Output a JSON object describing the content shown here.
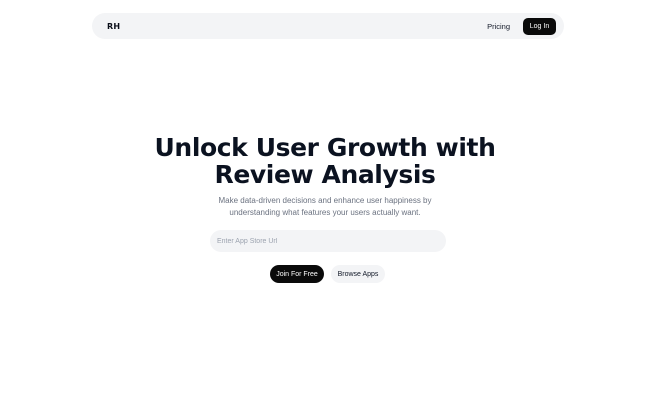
{
  "nav": {
    "logo": "RH",
    "pricing_label": "Pricing",
    "login_label": "Log In"
  },
  "hero": {
    "title_line1": "Unlock User Growth with",
    "title_line2": "Review Analysis",
    "subtitle": "Make data-driven decisions and enhance user happiness by understanding what features your users actually want."
  },
  "search": {
    "value": "",
    "placeholder": "Enter App Store Url"
  },
  "cta": {
    "primary_label": "Join For Free",
    "secondary_label": "Browse Apps"
  },
  "colors": {
    "background": "#ffffff",
    "surface": "#f3f4f6",
    "primary": "#0a0a0a",
    "muted_text": "#6b7280"
  }
}
